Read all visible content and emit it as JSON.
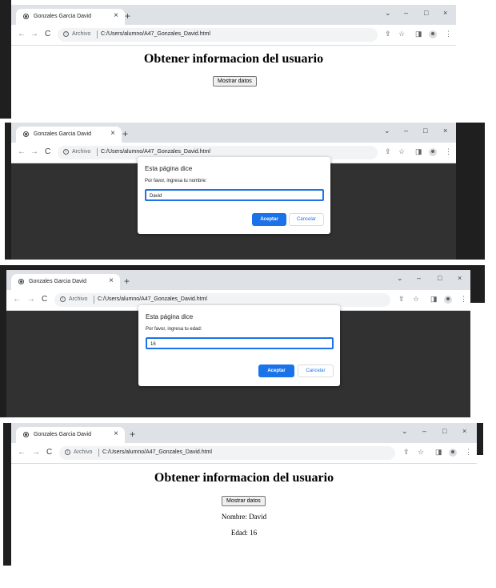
{
  "browser": {
    "tab_title": "Gonzales Garcia David",
    "scheme_label": "Archivo",
    "url": "C:/Users/alumno/A47_Gonzales_David.html",
    "close_tab_glyph": "×",
    "new_tab_glyph": "+",
    "back_glyph": "←",
    "forward_glyph": "→",
    "reload_glyph": "C",
    "info_glyph": "i",
    "dropdown_glyph": "⌄",
    "minimize_glyph": "–",
    "maximize_glyph": "□",
    "close_window_glyph": "×",
    "share_glyph": "⇪",
    "star_glyph": "☆",
    "sidepanel_glyph": "◨",
    "menu_glyph": "⋮"
  },
  "page": {
    "heading": "Obtener informacion del usuario",
    "button_label": "Mostrar datos",
    "result_name": "Nombre: David",
    "result_age": "Edad: 16"
  },
  "dialog_name": {
    "title": "Esta página dice",
    "message": "Por favor, ingresa tu nombre:",
    "input_value": "David",
    "ok_label": "Aceptar",
    "cancel_label": "Cancelar"
  },
  "dialog_age": {
    "title": "Esta página dice",
    "message": "Por favor, ingresa tu edad:",
    "input_value": "16",
    "ok_label": "Aceptar",
    "cancel_label": "Cancelar"
  },
  "colors": {
    "accent": "#1a73e8",
    "titlebar": "#dee1e6",
    "dark_background": "#1f1f1f"
  }
}
